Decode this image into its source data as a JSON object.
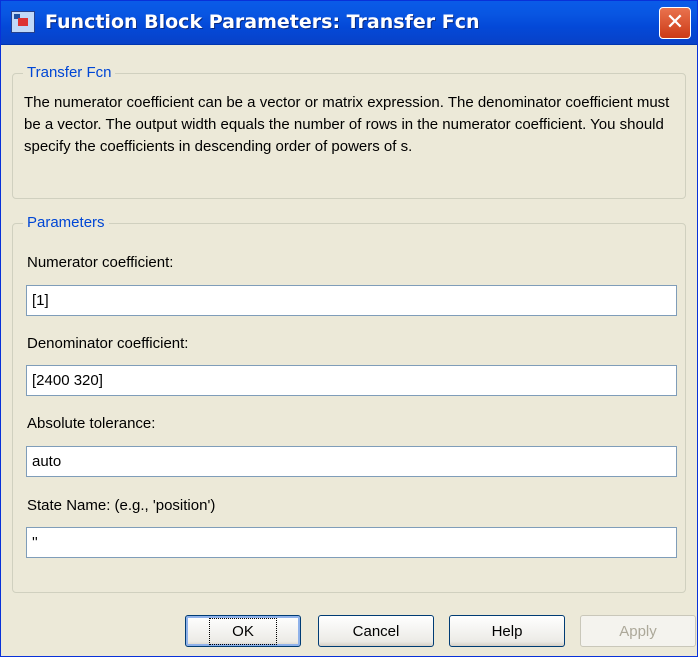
{
  "window": {
    "title": "Function Block Parameters: Transfer Fcn",
    "title_icon": "simulink-block-icon",
    "close_icon": "close-icon",
    "close_glyph": "✕"
  },
  "description_group": {
    "legend": "Transfer Fcn",
    "text": "The numerator coefficient can be a vector or matrix expression. The denominator coefficient must be a vector. The output width equals the number of rows in the numerator coefficient. You should specify the coefficients in descending order of powers of s."
  },
  "parameters_group": {
    "legend": "Parameters",
    "fields": [
      {
        "label": "Numerator coefficient:",
        "value": "[1]"
      },
      {
        "label": "Denominator coefficient:",
        "value": "[2400 320]"
      },
      {
        "label": "Absolute tolerance:",
        "value": "auto"
      },
      {
        "label": "State Name: (e.g., 'position')",
        "value": "''"
      }
    ]
  },
  "buttons": {
    "ok": "OK",
    "cancel": "Cancel",
    "help": "Help",
    "apply": "Apply"
  },
  "colors": {
    "titlebar": "#0a5be8",
    "legend_text": "#0046d5",
    "dialog_bg": "#ece9d8"
  }
}
